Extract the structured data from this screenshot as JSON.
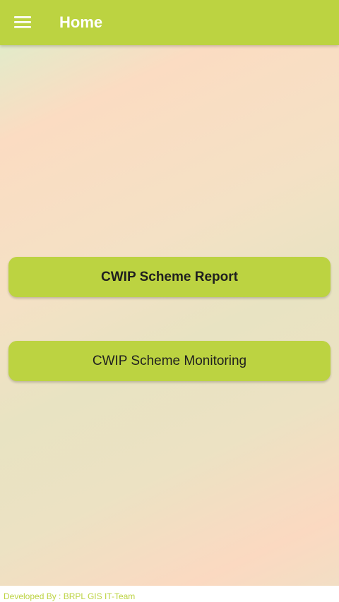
{
  "header": {
    "title": "Home",
    "menu_icon": "hamburger-menu-icon"
  },
  "main": {
    "buttons": [
      {
        "label": "CWIP Scheme Report"
      },
      {
        "label": "CWIP Scheme Monitoring"
      }
    ]
  },
  "footer": {
    "credit": "Developed By : BRPL GIS IT-Team"
  },
  "colors": {
    "accent": "#bcd341",
    "title_text": "#ffffff",
    "button_text": "#1f1f1f"
  }
}
